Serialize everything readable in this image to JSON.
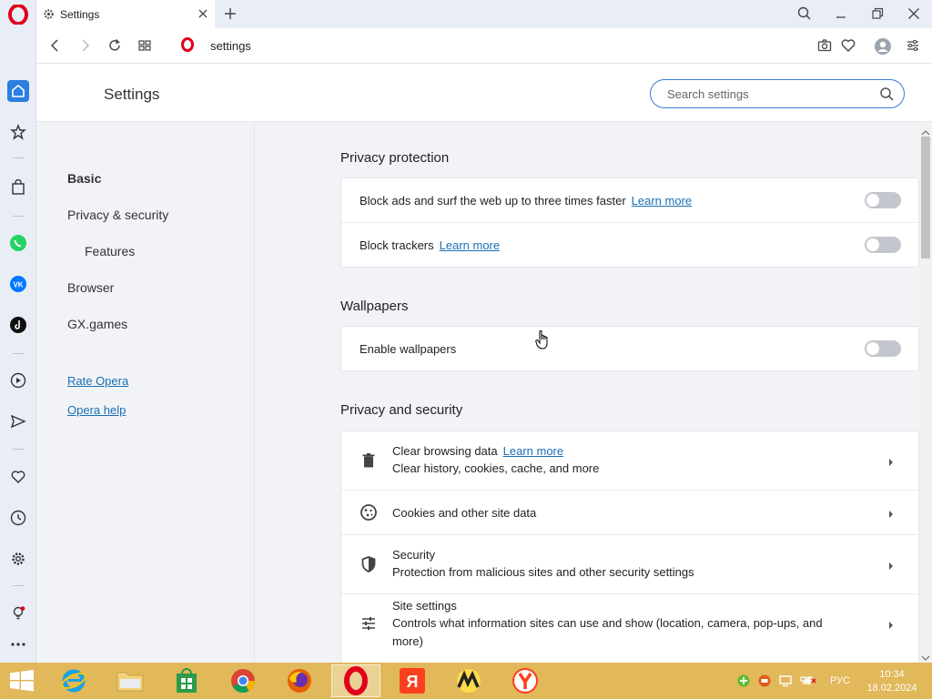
{
  "tab": {
    "title": "Settings"
  },
  "address": {
    "url": "settings"
  },
  "settings": {
    "title": "Settings",
    "search_placeholder": "Search settings"
  },
  "nav": {
    "items": [
      "Basic",
      "Privacy & security",
      "Features",
      "Browser",
      "GX.games"
    ],
    "links": [
      "Rate Opera",
      "Opera help"
    ]
  },
  "privacy_protection": {
    "title": "Privacy protection",
    "rows": [
      {
        "label": "Block ads and surf the web up to three times faster",
        "link": "Learn more",
        "enabled": false
      },
      {
        "label": "Block trackers",
        "link": "Learn more",
        "enabled": false
      }
    ]
  },
  "wallpapers": {
    "title": "Wallpapers",
    "rows": [
      {
        "label": "Enable wallpapers",
        "enabled": false
      }
    ]
  },
  "privacy_security": {
    "title": "Privacy and security",
    "rows": [
      {
        "title": "Clear browsing data",
        "link": "Learn more",
        "subtitle": "Clear history, cookies, cache, and more",
        "icon": "trash-icon"
      },
      {
        "title": "Cookies and other site data",
        "icon": "cookie-icon"
      },
      {
        "title": "Security",
        "subtitle": "Protection from malicious sites and other security settings",
        "icon": "shield-icon"
      },
      {
        "title": "Site settings",
        "subtitle": "Controls what information sites can use and show (location, camera, pop-ups, and more)",
        "icon": "sliders-icon"
      }
    ]
  },
  "taskbar": {
    "language": "РУС",
    "time": "10:34",
    "date": "18.02.2024"
  },
  "colors": {
    "accent": "#3a7bd5",
    "link": "#1a6fb5",
    "opera_red": "#e0001b",
    "taskbar": "#e1b85a"
  }
}
